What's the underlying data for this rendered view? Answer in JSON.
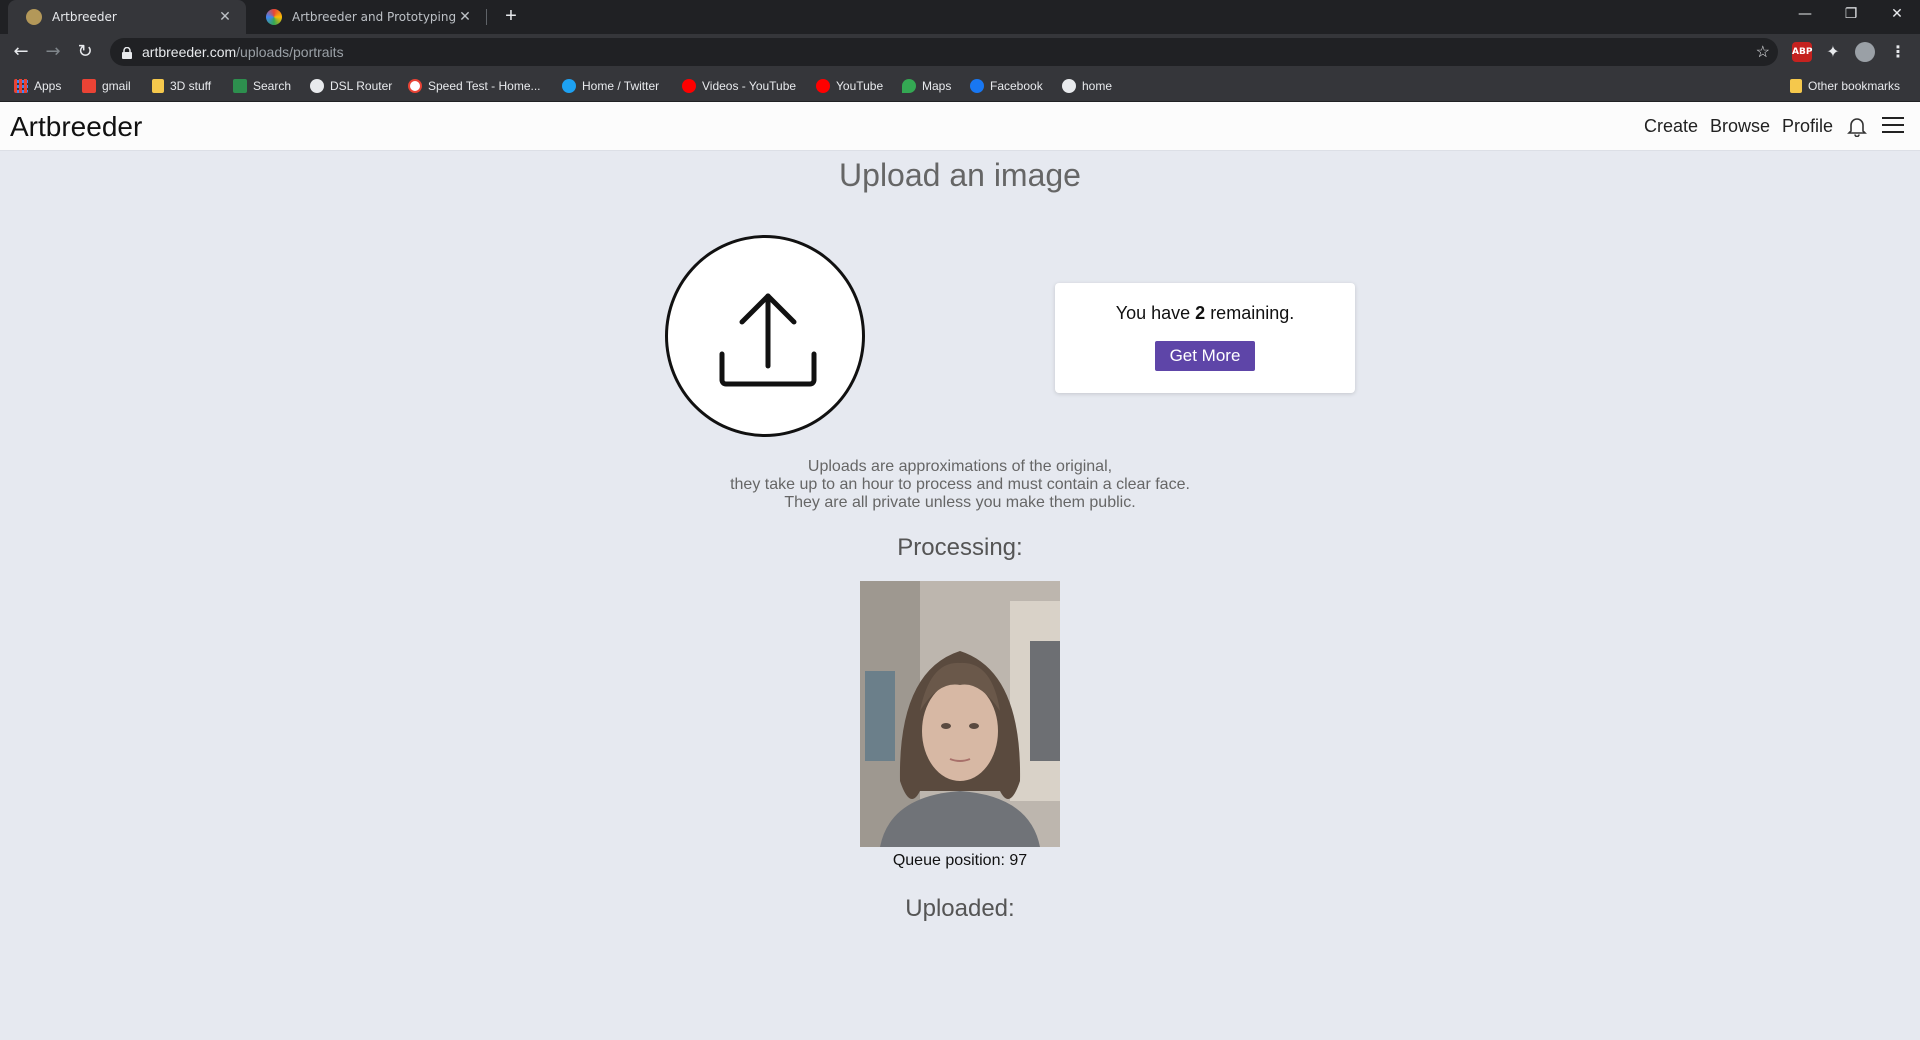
{
  "browser": {
    "tabs": [
      {
        "title": "Artbreeder",
        "active": true
      },
      {
        "title": "Artbreeder and Prototyping - Da",
        "active": false
      }
    ],
    "url_host": "artbreeder.com",
    "url_path": "/uploads/portraits",
    "extensions": [
      "ABP"
    ],
    "bookmarks": [
      {
        "label": "Apps",
        "icon": "apps-grid-icon"
      },
      {
        "label": "gmail",
        "icon": "gmail-icon"
      },
      {
        "label": "3D stuff",
        "icon": "folder-icon"
      },
      {
        "label": "Search",
        "icon": "search-engine-icon"
      },
      {
        "label": "DSL Router",
        "icon": "globe-icon"
      },
      {
        "label": "Speed Test - Home...",
        "icon": "speedtest-icon"
      },
      {
        "label": "Home / Twitter",
        "icon": "twitter-icon"
      },
      {
        "label": "Videos - YouTube",
        "icon": "youtube-icon"
      },
      {
        "label": "YouTube",
        "icon": "youtube-icon"
      },
      {
        "label": "Maps",
        "icon": "maps-icon"
      },
      {
        "label": "Facebook",
        "icon": "facebook-icon"
      },
      {
        "label": "home",
        "icon": "globe-icon"
      }
    ],
    "other_bookmarks": "Other bookmarks"
  },
  "header": {
    "brand": "Artbreeder",
    "nav": [
      "Create",
      "Browse",
      "Profile"
    ]
  },
  "main": {
    "title": "Upload an image",
    "remaining_prefix": "You have ",
    "remaining_count": "2",
    "remaining_suffix": " remaining.",
    "get_more_label": "Get More",
    "disclaimer": [
      "Uploads are approximations of the original,",
      "they take up to an hour to process and must contain a clear face.",
      "They are all private unless you make them public."
    ],
    "processing_title": "Processing:",
    "queue_position": "Queue position: 97",
    "uploaded_title": "Uploaded:"
  },
  "colors": {
    "page_bg": "#e6e9f0",
    "accent_button": "#5e45a8",
    "chrome_dark": "#202124",
    "chrome_mid": "#35363a"
  }
}
